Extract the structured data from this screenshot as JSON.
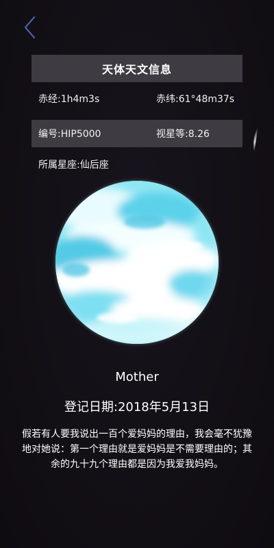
{
  "header": {
    "back_icon": "chevron-left-icon",
    "accent_color": "#4a5fa8"
  },
  "info_panel": {
    "title": "天体天文信息",
    "right_ascension": "赤经:1h4m3s",
    "declination": "赤纬:61°48m37s",
    "catalog_id": "编号:HIP5000",
    "magnitude": "视星等:8.26",
    "constellation": "所属星座:仙后座"
  },
  "star": {
    "name": "Mother",
    "registration_date": "登记日期:2018年5月13日",
    "message": "假若有人要我说出一百个爱妈妈的理由，我会毫不犹豫地对她说：第一个理由就是爱妈妈是不需要理由的；其余的九十九个理由都是因为我爱我妈妈。",
    "planet_colors": [
      "#ffffff",
      "#7fe3f2",
      "#4fc9e6"
    ]
  }
}
